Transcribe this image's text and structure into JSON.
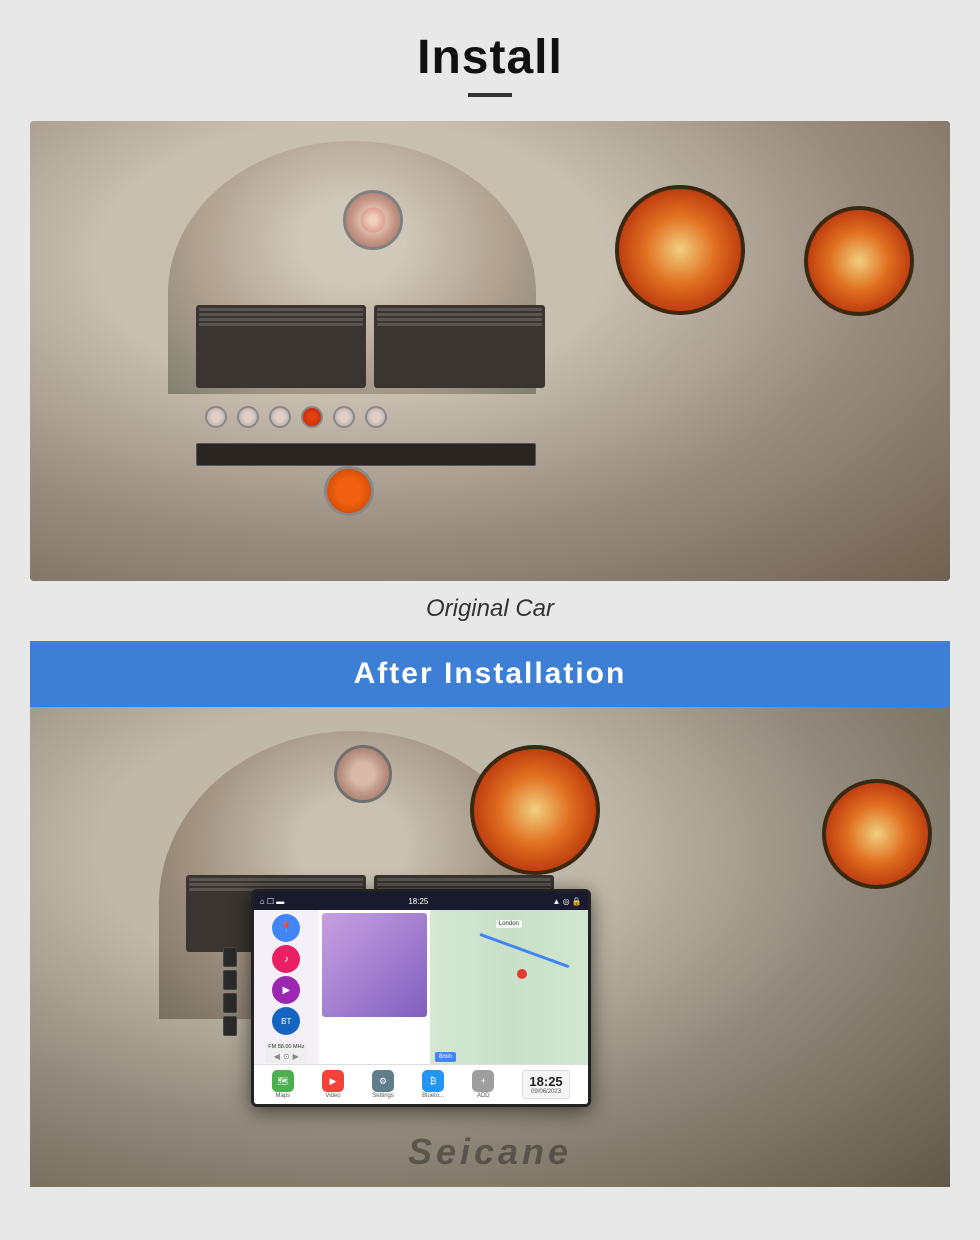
{
  "page": {
    "title": "Install",
    "background_color": "#e8e8e8"
  },
  "original_section": {
    "label": "Original Car"
  },
  "after_section": {
    "banner_text": "After  Installation"
  },
  "screen": {
    "status_time": "18:25",
    "status_icons": "▲ ◎ 🔒",
    "radio_freq": "FM 88.00 MHz",
    "time_display": "18:25",
    "date_display": "09/06/2023",
    "apps": {
      "maps": "Maps",
      "video": "Video",
      "settings": "Settings",
      "blue": "Blueto...",
      "add": "ADD"
    }
  },
  "watermark": {
    "text": "Seicane"
  }
}
